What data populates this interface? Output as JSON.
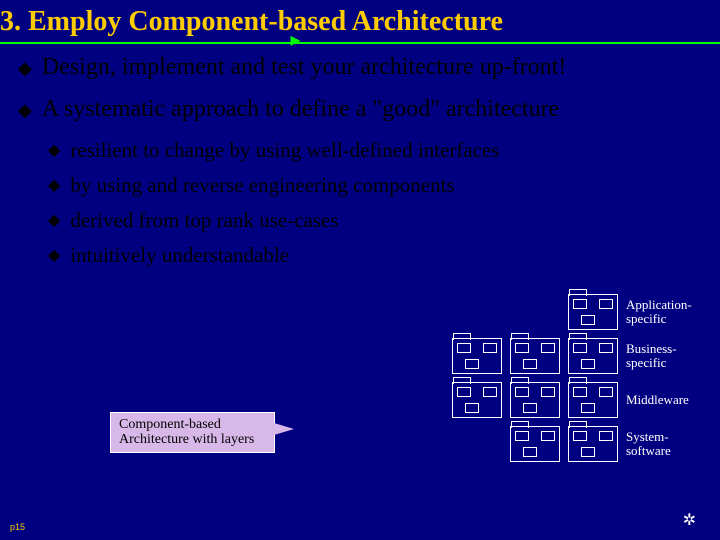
{
  "title": "3. Employ Component-based Architecture",
  "bullets_l1": [
    "Design, implement and test your architecture up-front!",
    "A systematic approach to define a \"good\" architecture"
  ],
  "bullets_l2": [
    "resilient to change by using well-defined interfaces",
    "by using and reverse engineering components",
    "derived from top rank use-cases",
    "intuitively understandable"
  ],
  "layers": [
    "Application-specific",
    "Business-specific",
    "Middleware",
    "System-software"
  ],
  "callout": "Component-based Architecture with layers",
  "page_label": "p15"
}
